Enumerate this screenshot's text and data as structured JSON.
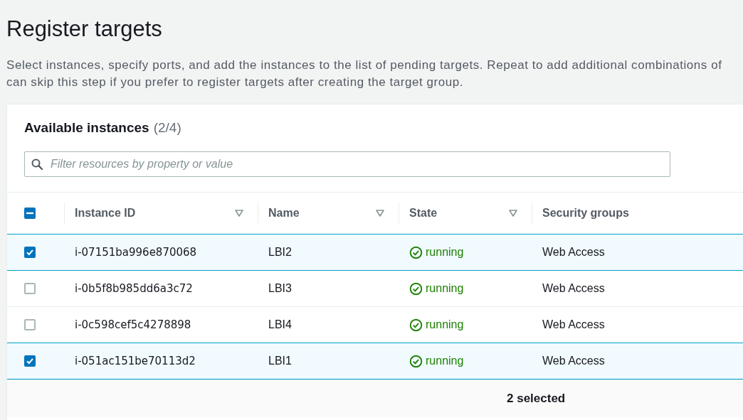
{
  "page": {
    "title": "Register targets",
    "description_lines": [
      "Select instances, specify ports, and add the instances to the list of pending targets. Repeat to add additional combinations of",
      "can skip this step if you prefer to register targets after creating the target group."
    ]
  },
  "panel": {
    "title": "Available instances",
    "count": "(2/4)",
    "search": {
      "placeholder": "Filter resources by property or value"
    },
    "select_all": {
      "indeterminate": true
    },
    "columns": [
      {
        "label": "Instance ID",
        "sortable": true
      },
      {
        "label": "Name",
        "sortable": true
      },
      {
        "label": "State",
        "sortable": true
      },
      {
        "label": "Security groups",
        "sortable": false
      }
    ],
    "rows": [
      {
        "selected": true,
        "instance_id": "i-07151ba996e870068",
        "name": "LBI2",
        "state": "running",
        "security_groups": "Web Access"
      },
      {
        "selected": false,
        "instance_id": "i-0b5f8b985dd6a3c72",
        "name": "LBI3",
        "state": "running",
        "security_groups": "Web Access"
      },
      {
        "selected": false,
        "instance_id": "i-0c598cef5c4278898",
        "name": "LBI4",
        "state": "running",
        "security_groups": "Web Access"
      },
      {
        "selected": true,
        "instance_id": "i-051ac151be70113d2",
        "name": "LBI1",
        "state": "running",
        "security_groups": "Web Access"
      }
    ],
    "footer": "2 selected"
  }
}
